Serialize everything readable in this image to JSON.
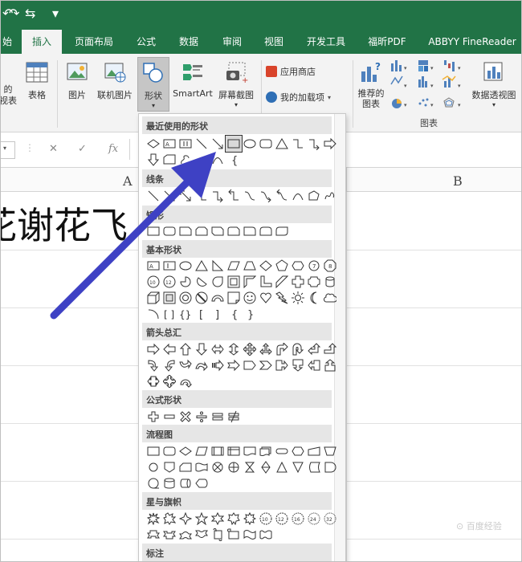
{
  "quick_access": {
    "undo": "↶",
    "redo": "↷",
    "touch": "⇆",
    "more": "▾"
  },
  "tabs": [
    {
      "label": "始",
      "active": false
    },
    {
      "label": "插入",
      "active": true
    },
    {
      "label": "页面布局",
      "active": false
    },
    {
      "label": "公式",
      "active": false
    },
    {
      "label": "数据",
      "active": false
    },
    {
      "label": "审阅",
      "active": false
    },
    {
      "label": "视图",
      "active": false
    },
    {
      "label": "开发工具",
      "active": false
    },
    {
      "label": "福昕PDF",
      "active": false
    },
    {
      "label": "ABBYY FineReader",
      "active": false
    }
  ],
  "ribbon": {
    "pivot_partial_1": "的",
    "pivot_partial_2": "视表",
    "table": "表格",
    "picture": "图片",
    "online_picture": "联机图片",
    "shapes": "形状",
    "smartart": "SmartArt",
    "screenshot": "屏幕截图",
    "app_store": "应用商店",
    "my_addins": "我的加载项",
    "recommended_charts_1": "推荐的",
    "recommended_charts_2": "图表",
    "chart_group_label": "图表",
    "pivot_chart": "数据透视图"
  },
  "formula_bar": {
    "cancel": "✕",
    "enter": "✓",
    "fx": "fx"
  },
  "grid": {
    "col_a": "A",
    "col_b": "B",
    "cell_text": "花谢花飞"
  },
  "shapes_panel": {
    "sections": [
      {
        "label": "最近使用的形状"
      },
      {
        "label": "线条"
      },
      {
        "label": "矩形"
      },
      {
        "label": "基本形状"
      },
      {
        "label": "箭头总汇"
      },
      {
        "label": "公式形状"
      },
      {
        "label": "流程图"
      },
      {
        "label": "星与旗帜"
      },
      {
        "label": "标注"
      }
    ]
  },
  "colors": {
    "accent": "#217346",
    "arrow": "#3e41c4"
  },
  "watermark": "⊙ 百度经验"
}
